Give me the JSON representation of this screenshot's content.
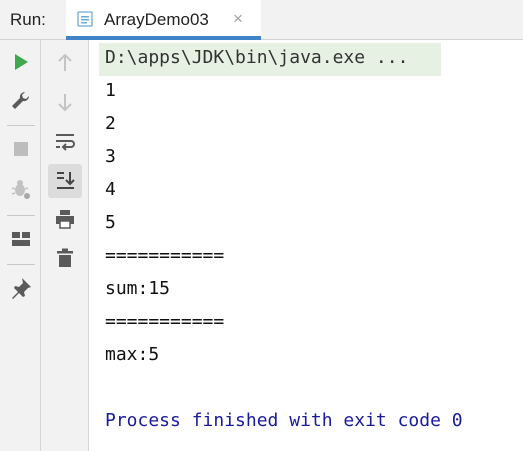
{
  "toolbar": {
    "run_label": "Run:",
    "tab_title": "ArrayDemo03",
    "close_glyph": "×"
  },
  "left_icons": [
    "run-icon",
    "wrench-icon",
    "stop-icon",
    "bug-settings-icon",
    "layout-icon",
    "pin-icon"
  ],
  "mid_icons": [
    "arrow-up-icon",
    "arrow-down-icon",
    "soft-wrap-icon",
    "scroll-to-end-icon",
    "print-icon",
    "trash-icon"
  ],
  "console": {
    "command": "D:\\apps\\JDK\\bin\\java.exe ...",
    "lines": [
      "1",
      "2",
      "3",
      "4",
      "5",
      "===========",
      "sum:15",
      "===========",
      "max:5"
    ],
    "finished": "Process finished with exit code 0"
  },
  "colors": {
    "run_green": "#3fa84e",
    "accent_blue": "#4083c9",
    "finished_text": "#1a1a9c",
    "command_bg": "#e7f1e3"
  }
}
